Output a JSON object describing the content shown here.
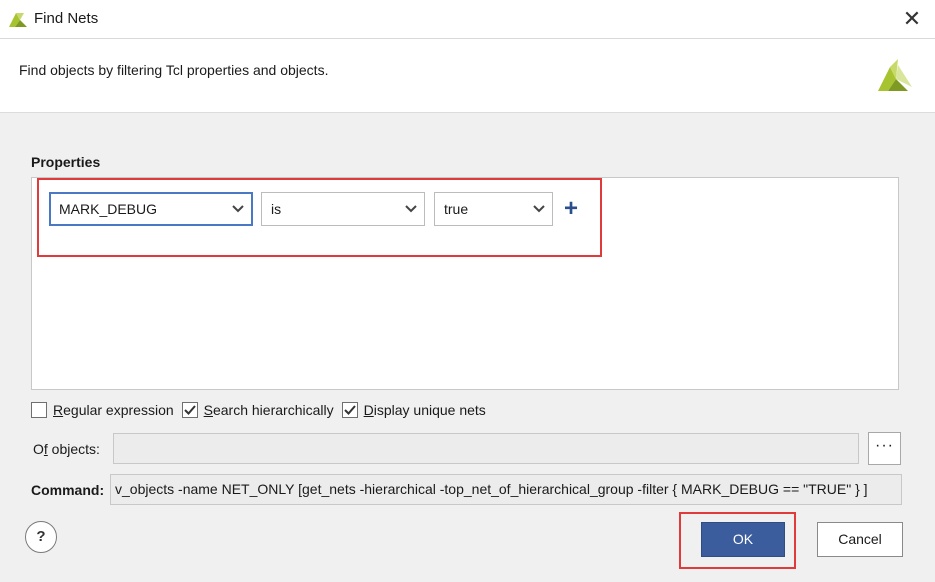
{
  "window": {
    "title": "Find Nets",
    "close_label": "✕"
  },
  "header": {
    "description": "Find objects by filtering Tcl properties and objects."
  },
  "properties": {
    "label": "Properties",
    "filter": {
      "property": "MARK_DEBUG",
      "operator": "is",
      "value": "true",
      "add_label": "+"
    }
  },
  "options": {
    "regex": {
      "label_ul": "R",
      "label_rest": "egular expression",
      "checked": false
    },
    "hier": {
      "label_ul": "S",
      "label_rest": "earch hierarchically",
      "checked": true
    },
    "unique": {
      "label_ul": "D",
      "label_rest": "isplay unique nets",
      "checked": true
    }
  },
  "of_objects": {
    "label_pre": "O",
    "label_ul": "f",
    "label_rest": " objects:",
    "value": "",
    "browse_label": "···"
  },
  "command": {
    "label": "Command:",
    "value": "v_objects -name NET_ONLY [get_nets -hierarchical -top_net_of_hierarchical_group -filter { MARK_DEBUG == \"TRUE\" } ]"
  },
  "footer": {
    "help_label": "?",
    "ok_label": "OK",
    "cancel_label": "Cancel"
  },
  "colors": {
    "accent": "#3b5d9d",
    "highlight": "#e03a3a",
    "xilinx_logo": "#a8c330"
  }
}
